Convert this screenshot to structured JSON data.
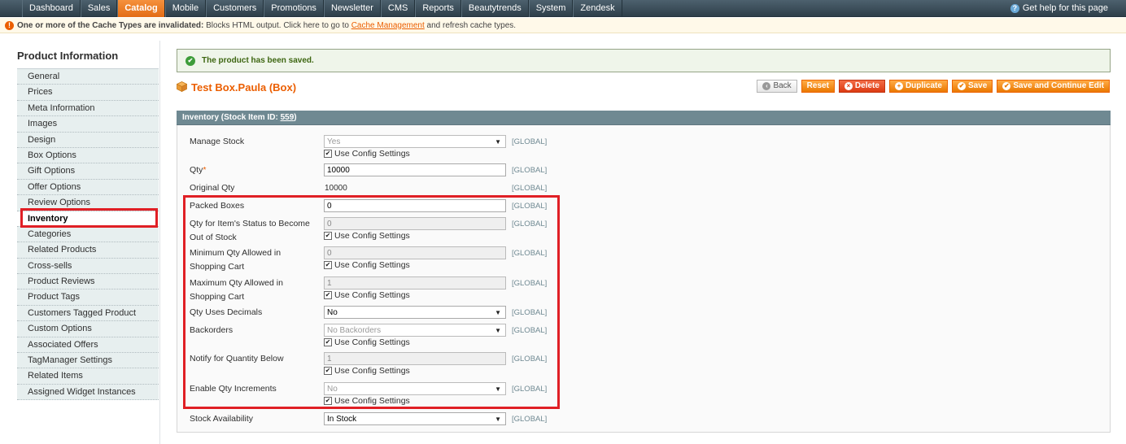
{
  "nav": {
    "items": [
      "Dashboard",
      "Sales",
      "Catalog",
      "Mobile",
      "Customers",
      "Promotions",
      "Newsletter",
      "CMS",
      "Reports",
      "Beautytrends",
      "System",
      "Zendesk"
    ],
    "active": "Catalog",
    "help": "Get help for this page"
  },
  "notice": {
    "bold": "One or more of the Cache Types are invalidated:",
    "text": " Blocks HTML output. Click here to go to ",
    "link": "Cache Management",
    "tail": " and refresh cache types."
  },
  "sidebar": {
    "title": "Product Information",
    "items": [
      "General",
      "Prices",
      "Meta Information",
      "Images",
      "Design",
      "Box Options",
      "Gift Options",
      "Offer Options",
      "Review Options",
      "Inventory",
      "Categories",
      "Related Products",
      "Cross-sells",
      "Product Reviews",
      "Product Tags",
      "Customers Tagged Product",
      "Custom Options",
      "Associated Offers",
      "TagManager Settings",
      "Related Items",
      "Assigned Widget Instances"
    ],
    "active": "Inventory"
  },
  "message": "The product has been saved.",
  "page_title": "Test Box.Paula (Box)",
  "buttons": {
    "back": "Back",
    "reset": "Reset",
    "delete": "Delete",
    "duplicate": "Duplicate",
    "save": "Save",
    "save_continue": "Save and Continue Edit"
  },
  "fieldset": {
    "title_prefix": "Inventory (Stock Item ID: ",
    "stock_item_id": "559",
    "title_suffix": ")"
  },
  "scope_label": "[GLOBAL]",
  "use_config": "Use Config Settings",
  "fields": {
    "manage_stock": {
      "label": "Manage Stock",
      "value": "Yes"
    },
    "qty": {
      "label": "Qty",
      "required": "*",
      "value": "10000"
    },
    "original_qty": {
      "label": "Original Qty",
      "value": "10000"
    },
    "packed_boxes": {
      "label": "Packed Boxes",
      "value": "0"
    },
    "out_of_stock": {
      "label": "Qty for Item's Status to Become Out of Stock",
      "value": "0"
    },
    "min_qty": {
      "label": "Minimum Qty Allowed in Shopping Cart",
      "value": "0"
    },
    "max_qty": {
      "label": "Maximum Qty Allowed in Shopping Cart",
      "value": "1"
    },
    "qty_decimals": {
      "label": "Qty Uses Decimals",
      "value": "No"
    },
    "backorders": {
      "label": "Backorders",
      "value": "No Backorders"
    },
    "notify_below": {
      "label": "Notify for Quantity Below",
      "value": "1"
    },
    "qty_increments": {
      "label": "Enable Qty Increments",
      "value": "No"
    },
    "stock_availability": {
      "label": "Stock Availability",
      "value": "In Stock"
    }
  }
}
